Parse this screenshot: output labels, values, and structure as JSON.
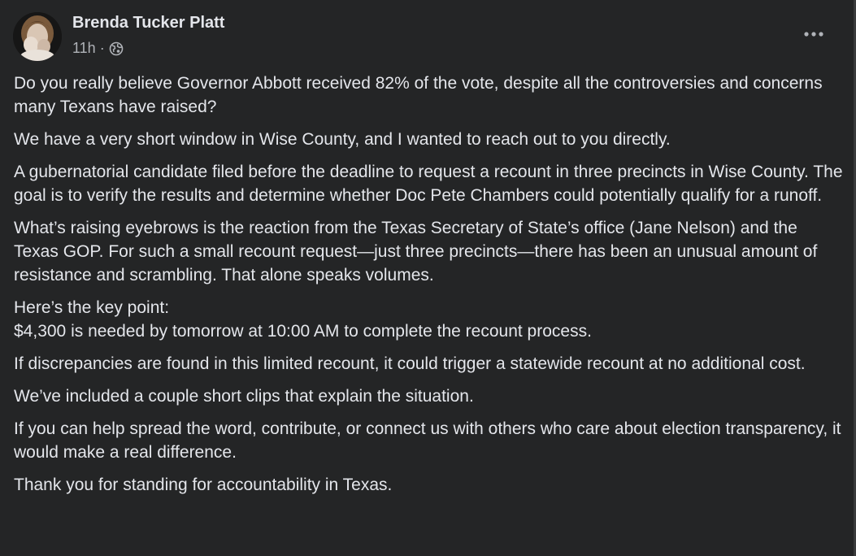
{
  "post": {
    "author": "Brenda Tucker Platt",
    "time": "11h",
    "separator": "·",
    "privacy_icon": "globe-icon",
    "more_icon": "more-options-icon",
    "paragraphs": [
      "Do you really believe Governor Abbott received 82% of the vote, despite all the controversies and concerns many Texans have raised?",
      "We have a very short window in Wise County, and I wanted to reach out to you directly.",
      "A gubernatorial candidate filed before the deadline to request a recount in three precincts in Wise County. The goal is to verify the results and determine whether Doc Pete Chambers could potentially qualify for a runoff.",
      "What’s raising eyebrows is the reaction from the Texas Secretary of State’s office (Jane Nelson) and the Texas GOP. For such a small recount request—just three precincts—there has been an unusual amount of resistance and scrambling. That alone speaks volumes.",
      "Here’s the key point:",
      "$4,300 is needed by tomorrow at 10:00 AM to complete the recount process.",
      "If discrepancies are found in this limited recount, it could trigger a statewide recount at no additional cost.",
      "We’ve included a couple short clips that explain the situation.",
      "If you can help spread the word, contribute, or connect us with others who care about election transparency, it would make a real difference.",
      "Thank you for standing for accountability in Texas."
    ]
  },
  "colors": {
    "background": "#242526",
    "primary_text": "#e4e6eb",
    "secondary_text": "#b0b3b8"
  }
}
